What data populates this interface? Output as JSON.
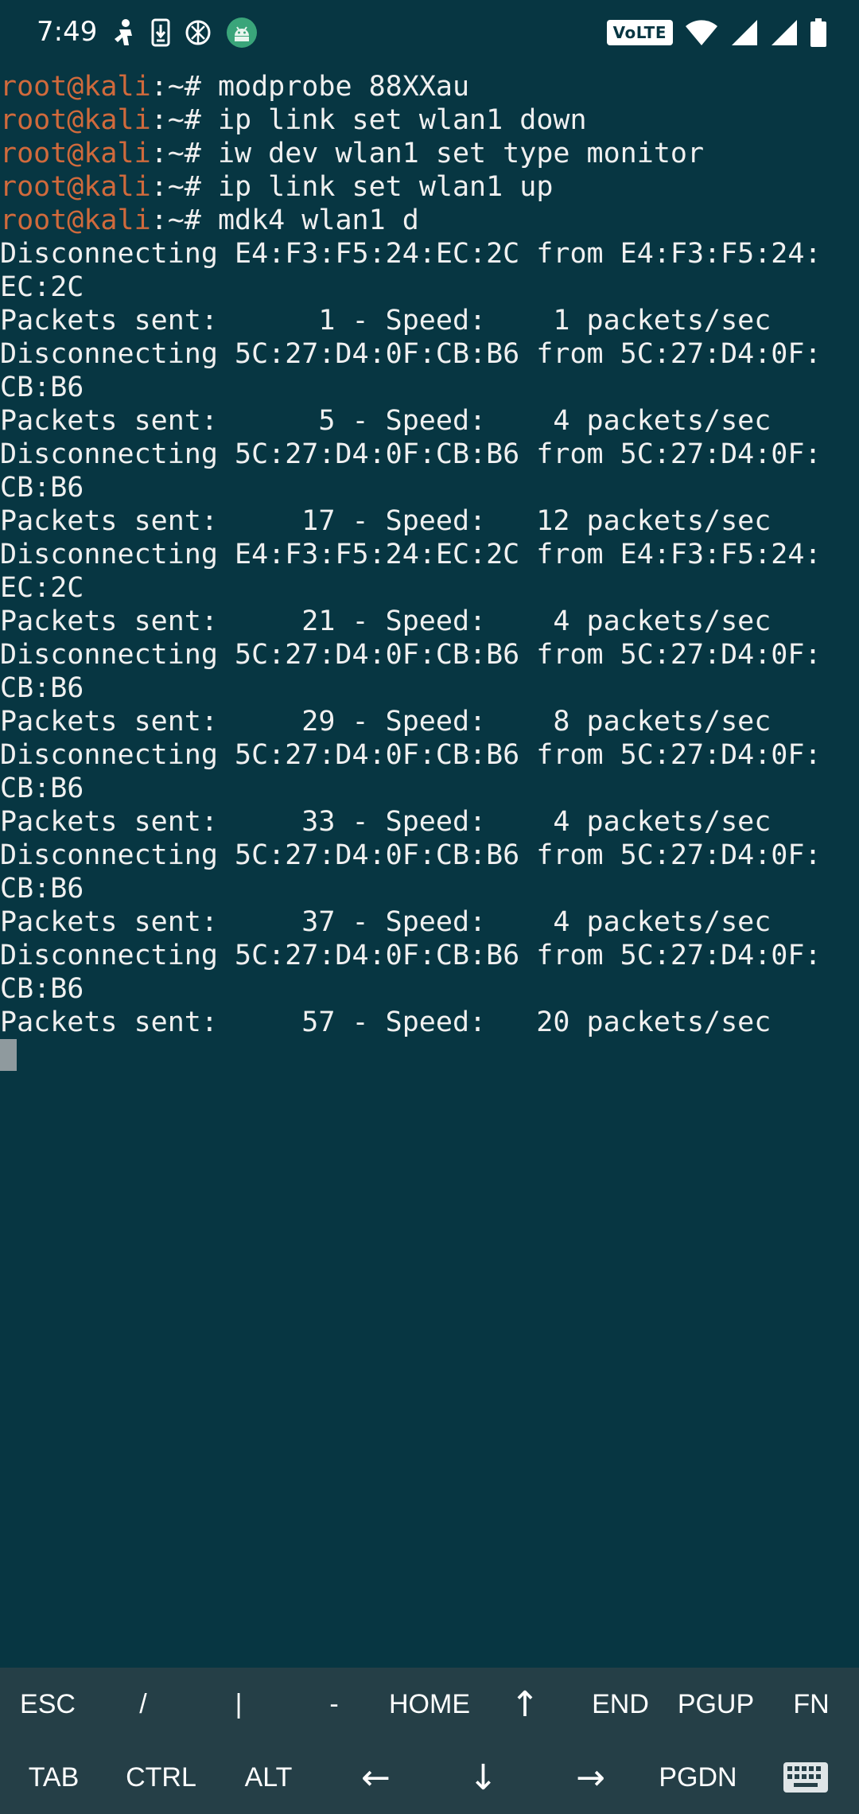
{
  "status_bar": {
    "time": "7:49",
    "left_icons": [
      "figure-icon",
      "download-icon",
      "aperture-icon",
      "android-icon"
    ],
    "volte_label": "VoLTE",
    "right_icons": [
      "wifi-icon",
      "signal-icon",
      "signal-icon",
      "battery-icon"
    ]
  },
  "terminal": {
    "prompt_user": "root@kali",
    "prompt_sep": ":~# ",
    "commands": [
      "modprobe 88XXau",
      "ip link set wlan1 down",
      "iw dev wlan1 set type monitor",
      "ip link set wlan1 up",
      "mdk4 wlan1 d"
    ],
    "output_lines": [
      "Disconnecting E4:F3:F5:24:EC:2C from E4:F3:F5:24:",
      "EC:2C",
      "Packets sent:      1 - Speed:    1 packets/sec",
      "Disconnecting 5C:27:D4:0F:CB:B6 from 5C:27:D4:0F:",
      "CB:B6",
      "Packets sent:      5 - Speed:    4 packets/sec",
      "Disconnecting 5C:27:D4:0F:CB:B6 from 5C:27:D4:0F:",
      "CB:B6",
      "Packets sent:     17 - Speed:   12 packets/sec",
      "Disconnecting E4:F3:F5:24:EC:2C from E4:F3:F5:24:",
      "EC:2C",
      "Packets sent:     21 - Speed:    4 packets/sec",
      "Disconnecting 5C:27:D4:0F:CB:B6 from 5C:27:D4:0F:",
      "CB:B6",
      "Packets sent:     29 - Speed:    8 packets/sec",
      "Disconnecting 5C:27:D4:0F:CB:B6 from 5C:27:D4:0F:",
      "CB:B6",
      "Packets sent:     33 - Speed:    4 packets/sec",
      "Disconnecting 5C:27:D4:0F:CB:B6 from 5C:27:D4:0F:",
      "CB:B6",
      "Packets sent:     37 - Speed:    4 packets/sec",
      "Disconnecting 5C:27:D4:0F:CB:B6 from 5C:27:D4:0F:",
      "CB:B6",
      "Packets sent:     57 - Speed:   20 packets/sec"
    ]
  },
  "extra_keys": {
    "row1": [
      {
        "label": "ESC",
        "name": "key-esc"
      },
      {
        "label": "/",
        "name": "key-slash"
      },
      {
        "label": "|",
        "name": "key-pipe"
      },
      {
        "label": "-",
        "name": "key-dash"
      },
      {
        "label": "HOME",
        "name": "key-home"
      },
      {
        "label": "↑",
        "name": "key-arrow-up"
      },
      {
        "label": "END",
        "name": "key-end"
      },
      {
        "label": "PGUP",
        "name": "key-pgup"
      },
      {
        "label": "FN",
        "name": "key-fn"
      }
    ],
    "row2": [
      {
        "label": "TAB",
        "name": "key-tab"
      },
      {
        "label": "CTRL",
        "name": "key-ctrl"
      },
      {
        "label": "ALT",
        "name": "key-alt"
      },
      {
        "label": "←",
        "name": "key-arrow-left"
      },
      {
        "label": "↓",
        "name": "key-arrow-down"
      },
      {
        "label": "→",
        "name": "key-arrow-right"
      },
      {
        "label": "PGDN",
        "name": "key-pgdn"
      },
      {
        "label": "",
        "name": "keyboard-toggle",
        "icon": "keyboard-icon"
      }
    ]
  },
  "colors": {
    "background": "#073642",
    "prompt_user": "#d06a3c",
    "text": "#f0f0f0",
    "extra_keys_background": "#253f47",
    "cursor": "#8f9a9e"
  }
}
